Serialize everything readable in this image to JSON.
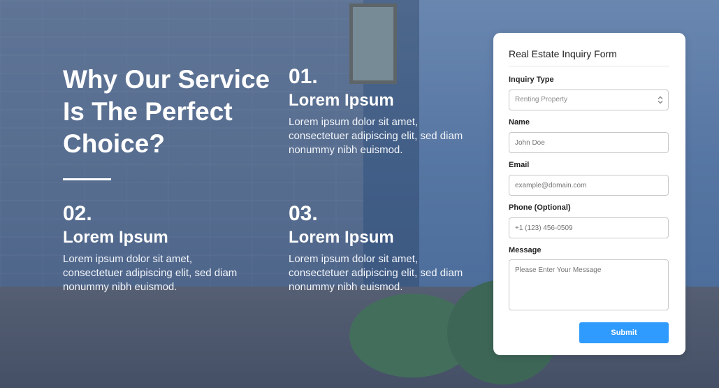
{
  "hero": {
    "headline": "Why Our Service Is The Perfect Choice?"
  },
  "features": [
    {
      "number": "01.",
      "title": "Lorem Ipsum",
      "description": "Lorem ipsum dolor sit amet, consectetuer adipiscing elit, sed diam nonummy nibh euismod."
    },
    {
      "number": "02.",
      "title": "Lorem Ipsum",
      "description": "Lorem ipsum dolor sit amet, consectetuer adipiscing elit, sed diam nonummy nibh euismod."
    },
    {
      "number": "03.",
      "title": "Lorem Ipsum",
      "description": "Lorem ipsum dolor sit amet, consectetuer adipiscing elit, sed diam nonummy nibh euismod."
    }
  ],
  "form": {
    "title": "Real Estate Inquiry Form",
    "inquiry_type": {
      "label": "Inquiry Type",
      "value": "Renting Property"
    },
    "name": {
      "label": "Name",
      "placeholder": "John Doe"
    },
    "email": {
      "label": "Email",
      "placeholder": "example@domain.com"
    },
    "phone": {
      "label": "Phone (Optional)",
      "placeholder": "+1 (123) 456-0509"
    },
    "message": {
      "label": "Message",
      "placeholder": "Please Enter Your Message"
    },
    "submit_label": "Submit"
  },
  "colors": {
    "overlay": "#284b82",
    "button": "#2f9bff",
    "text_on_hero": "#ffffff"
  },
  "icons": {
    "select_arrow": "chevron-up-down-icon"
  }
}
